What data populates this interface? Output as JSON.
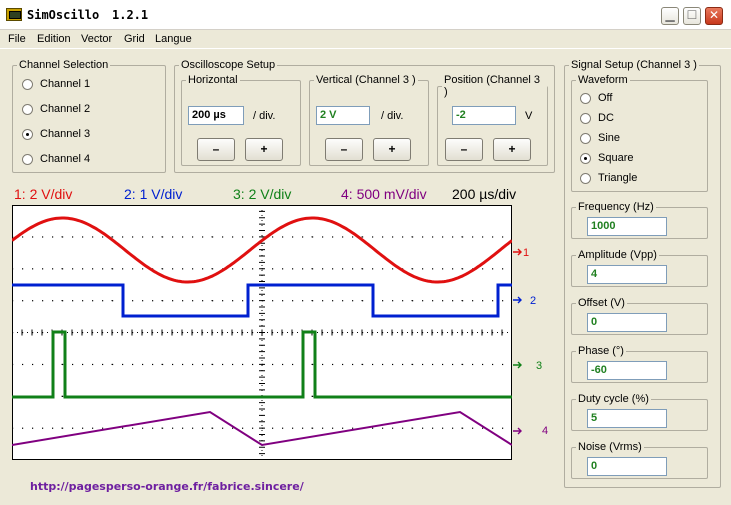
{
  "window": {
    "title": "SimOscillo",
    "version": "1.2.1",
    "min_glyph": "▁",
    "max_glyph": "☐",
    "close_glyph": "✕"
  },
  "menu": [
    "File",
    "Edition",
    "Vector",
    "Grid",
    "Langue"
  ],
  "channel_selection": {
    "legend": "Channel Selection",
    "options": [
      "Channel 1",
      "Channel 2",
      "Channel 3",
      "Channel 4"
    ],
    "selected": 2
  },
  "oscilloscope_setup": {
    "legend": "Oscilloscope Setup",
    "horizontal": {
      "legend": "Horizontal",
      "value": "200 µs",
      "unit": "/ div."
    },
    "vertical": {
      "legend": "Vertical (Channel 3 )",
      "value": "2 V",
      "unit": "/ div."
    },
    "position": {
      "legend": "Position (Channel 3 )",
      "value": "-2",
      "unit": "V"
    },
    "minus_label": "–",
    "plus_label": "+"
  },
  "scope": {
    "ch1_scale": "1: 2 V/div",
    "ch2_scale": "2: 1 V/div",
    "ch3_scale": "3: 2 V/div",
    "ch4_scale": "4: 500 mV/div",
    "timebase": "200 µs/div",
    "colors": {
      "ch1": "#e01010",
      "ch2": "#0020d0",
      "ch3": "#108018",
      "ch4": "#800080"
    },
    "markers": [
      "1",
      "2",
      "3",
      "4"
    ],
    "grid": true
  },
  "signal_setup": {
    "legend": "Signal Setup (Channel 3 )",
    "waveform_legend": "Waveform",
    "waveforms": [
      "Off",
      "DC",
      "Sine",
      "Square",
      "Triangle"
    ],
    "selected_waveform": 3,
    "frequency": {
      "label": "Frequency (Hz)",
      "value": "1000"
    },
    "amplitude": {
      "label": "Amplitude (Vpp)",
      "value": "4"
    },
    "offset": {
      "label": "Offset (V)",
      "value": "0"
    },
    "phase": {
      "label": "Phase (°)",
      "value": "-60"
    },
    "duty_cycle": {
      "label": "Duty cycle (%)",
      "value": "5"
    },
    "noise": {
      "label": "Noise (Vrms)",
      "value": "0"
    }
  },
  "footer_link": "http://pagesperso-orange.fr/fabrice.sincere/"
}
